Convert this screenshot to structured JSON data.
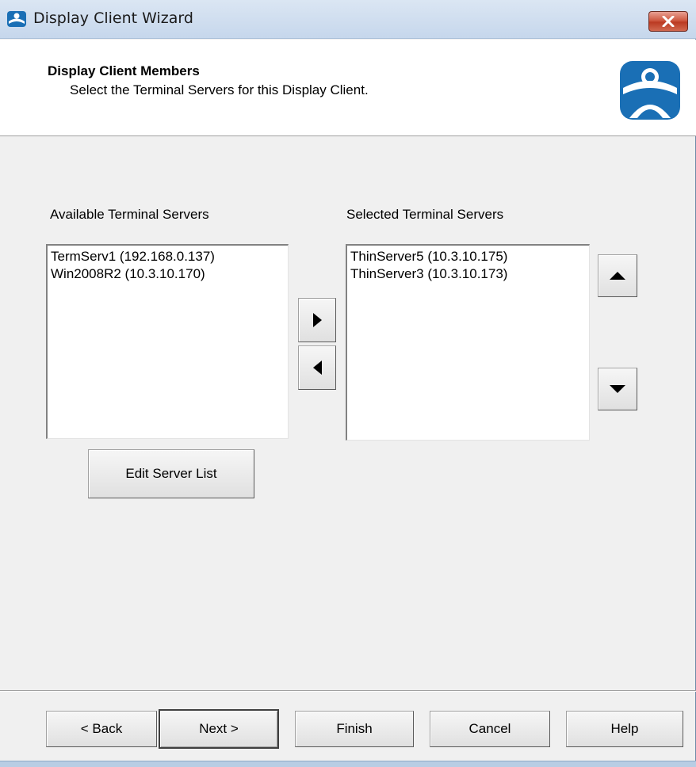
{
  "window": {
    "title": "Display Client Wizard"
  },
  "header": {
    "title": "Display Client Members",
    "subtitle": "Select the Terminal Servers for this Display Client."
  },
  "available": {
    "label": "Available Terminal Servers",
    "items": [
      "TermServ1 (192.168.0.137)",
      "Win2008R2 (10.3.10.170)"
    ],
    "edit_button": "Edit Server List"
  },
  "selected": {
    "label": "Selected Terminal Servers",
    "items": [
      "ThinServer5 (10.3.10.175)",
      "ThinServer3 (10.3.10.173)"
    ]
  },
  "footer": {
    "back": "< Back",
    "next": "Next >",
    "finish": "Finish",
    "cancel": "Cancel",
    "help": "Help"
  },
  "icons": {
    "app": "thinmanager-logo-icon",
    "close": "close-icon",
    "move_right": "arrow-right-icon",
    "move_left": "arrow-left-icon",
    "move_up": "arrow-up-icon",
    "move_down": "arrow-down-icon"
  },
  "colors": {
    "accent_blue": "#1a6fb5",
    "close_red": "#c94b33"
  }
}
